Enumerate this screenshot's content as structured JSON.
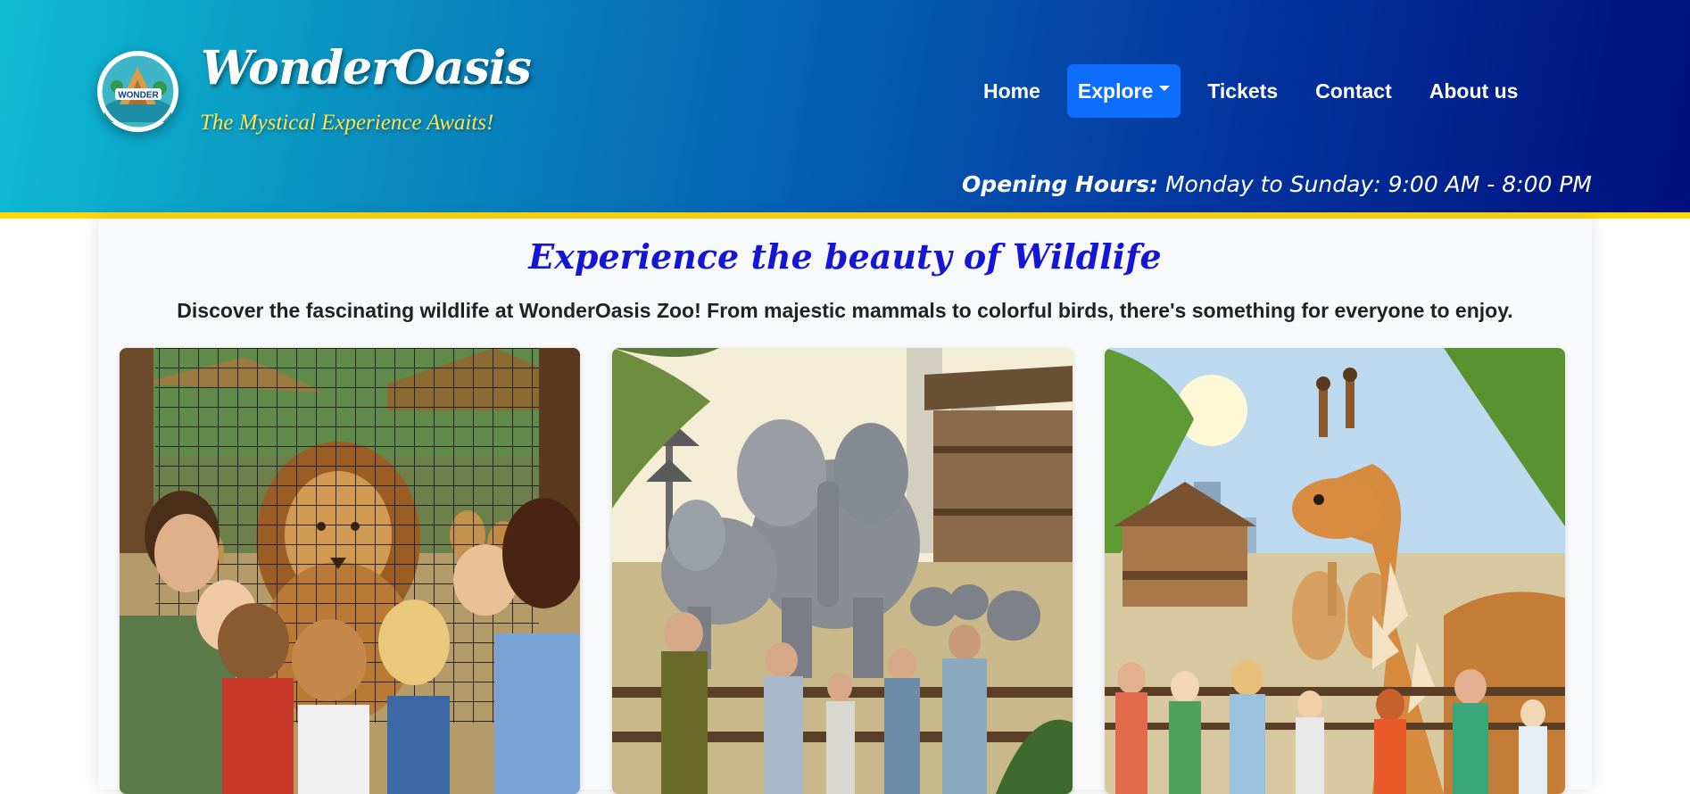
{
  "brand": {
    "name": "WonderOasis",
    "tagline": "The Mystical Experience Awaits!",
    "logo_text": "WONDER",
    "logo_icon": "zoo-logo-badge"
  },
  "nav": {
    "items": [
      {
        "label": "Home",
        "active": false
      },
      {
        "label": "Explore",
        "active": true,
        "has_dropdown": true,
        "icon": "caret-down-icon"
      },
      {
        "label": "Tickets",
        "active": false
      },
      {
        "label": "Contact",
        "active": false
      },
      {
        "label": "About us",
        "active": false
      }
    ]
  },
  "hours": {
    "label": "Opening Hours:",
    "value": "Monday to Sunday: 9:00 AM - 8:00 PM"
  },
  "section": {
    "title": "Experience the beauty of Wildlife",
    "lead": "Discover the fascinating wildlife at WonderOasis Zoo! From majestic mammals to colorful birds, there's something for everyone to enjoy."
  },
  "gallery": [
    {
      "subject": "lion-enclosure-photo"
    },
    {
      "subject": "elephant-habitat-photo"
    },
    {
      "subject": "giraffe-viewing-photo"
    }
  ],
  "colors": {
    "header_start": "#0fbcd6",
    "header_end": "#000f7c",
    "accent_border": "#ffd60a",
    "nav_active": "#0d6efd",
    "title": "#1515d6",
    "tagline": "#ffe34a"
  }
}
